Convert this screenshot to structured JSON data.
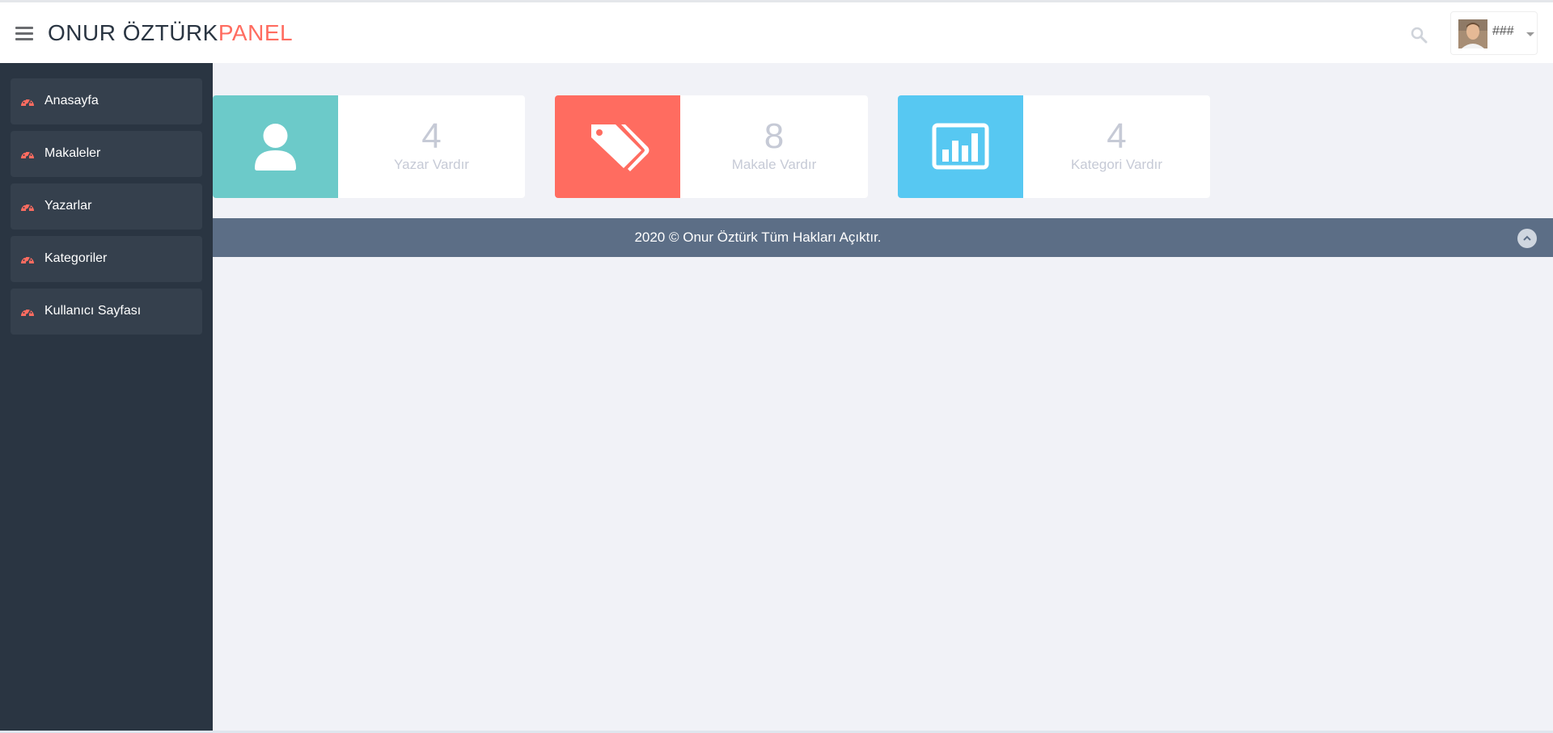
{
  "header": {
    "brand_main": "ONUR ÖZTÜRK",
    "brand_accent": "PANEL",
    "user_name": "###",
    "icons": [
      "menu-icon",
      "search-icon",
      "avatar",
      "caret-down-icon"
    ]
  },
  "sidebar": {
    "items": [
      {
        "label": "Anasayfa",
        "icon": "dashboard-icon"
      },
      {
        "label": "Makaleler",
        "icon": "dashboard-icon"
      },
      {
        "label": "Yazarlar",
        "icon": "dashboard-icon"
      },
      {
        "label": "Kategoriler",
        "icon": "dashboard-icon"
      },
      {
        "label": "Kullanıcı Sayfası",
        "icon": "dashboard-icon"
      }
    ]
  },
  "stats": [
    {
      "value": "4",
      "label": "Yazar Vardır",
      "icon": "user-icon",
      "color": "#6ccac9"
    },
    {
      "value": "8",
      "label": "Makale Vardır",
      "icon": "tags-icon",
      "color": "#ff6c60"
    },
    {
      "value": "4",
      "label": "Kategori Vardır",
      "icon": "bar-chart-icon",
      "color": "#57c8f2"
    }
  ],
  "footer": {
    "text": "2020 © Onur Öztürk Tüm Hakları Açıktır.",
    "scroll_icon": "chevron-up-icon"
  },
  "colors": {
    "sidebar_bg": "#2a3542",
    "sidebar_item_bg": "#35404d",
    "accent": "#ff6c60",
    "footer_bg": "#5c6e86",
    "page_bg": "#f1f2f7"
  }
}
